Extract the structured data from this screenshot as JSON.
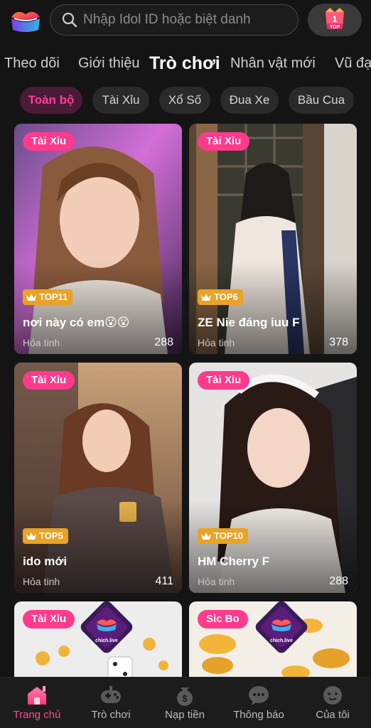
{
  "search": {
    "placeholder": "Nhập Idol ID hoặc biệt danh"
  },
  "top_button": {
    "label": "TOP",
    "number": "1"
  },
  "tabs": [
    {
      "label": "Theo dõi"
    },
    {
      "label": "Giới thiệu"
    },
    {
      "label": "Trò chơi",
      "active": true
    },
    {
      "label": "Nhân vật mới"
    },
    {
      "label": "Vũ đạo"
    }
  ],
  "filters": [
    {
      "label": "Toàn bộ",
      "active": true
    },
    {
      "label": "Tài Xỉu"
    },
    {
      "label": "Xổ Số"
    },
    {
      "label": "Đua Xe"
    },
    {
      "label": "Bầu Cua"
    }
  ],
  "cards": [
    {
      "category": "Tài Xỉu",
      "rank": "TOP11",
      "title": "nơi này có em😮😮",
      "location": "Hỏa tinh",
      "count": "288"
    },
    {
      "category": "Tài Xỉu",
      "rank": "TOP6",
      "title": "ZE Nie đáng iuu F",
      "location": "Hỏa tinh",
      "count": "378"
    },
    {
      "category": "Tài Xỉu",
      "rank": "TOP5",
      "title": "ido mới",
      "location": "Hỏa tinh",
      "count": "411"
    },
    {
      "category": "Tài Xỉu",
      "rank": "TOP10",
      "title": "HM Cherry F",
      "location": "Hỏa tinh",
      "count": "288"
    },
    {
      "category": "Tài Xỉu",
      "logo_text": "chich.live"
    },
    {
      "category": "Sic Bo",
      "logo_text": "chich.live"
    }
  ],
  "bottom_nav": [
    {
      "label": "Trang chủ",
      "active": true
    },
    {
      "label": "Trò chơi"
    },
    {
      "label": "Nạp tiền"
    },
    {
      "label": "Thông báo"
    },
    {
      "label": "Của tôi"
    }
  ],
  "colors": {
    "accent": "#ff3a8c",
    "background": "#141414",
    "rank": "#e9a326",
    "filter_active_text": "#ff3f9a"
  }
}
